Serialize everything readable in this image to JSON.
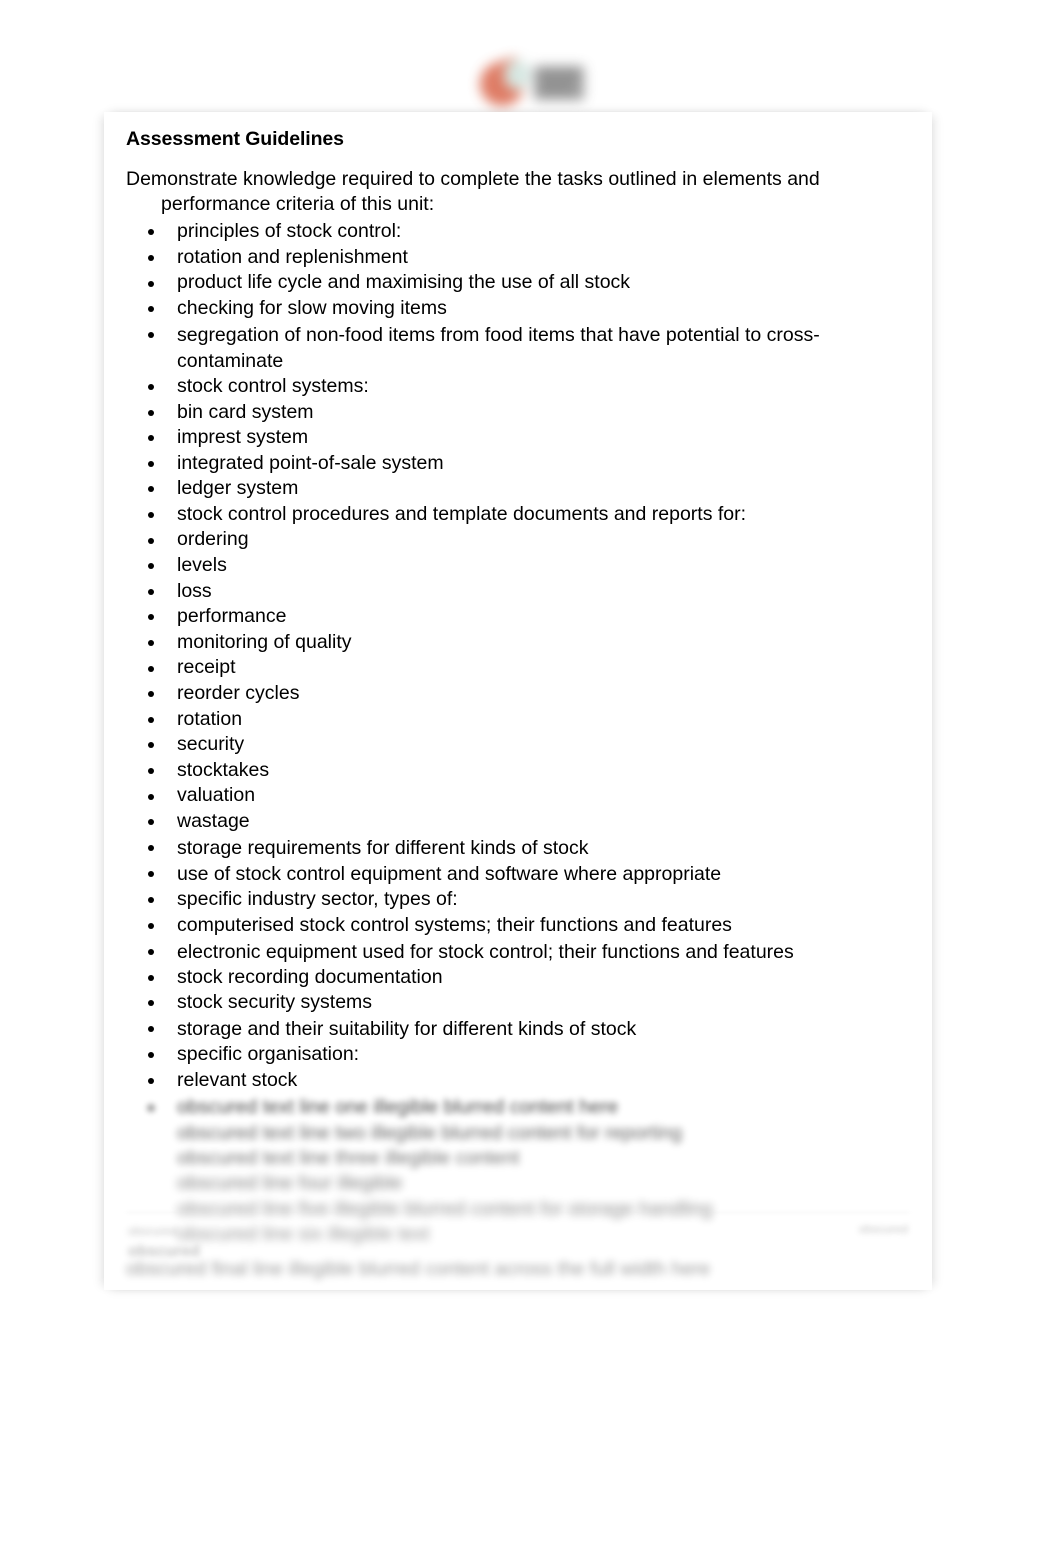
{
  "document": {
    "heading": "Assessment Guidelines",
    "intro": {
      "line1": "Demonstrate knowledge required to complete the tasks outlined in elements and",
      "line2": "performance criteria of this unit:"
    },
    "bullets": [
      "principles of stock control:",
      "rotation and replenishment",
      "product life cycle and maximising the use of all stock",
      "checking for slow moving items",
      "segregation of non-food items from food items that have potential to cross-contaminate",
      "stock control systems:",
      "bin card system",
      "imprest system",
      "integrated point-of-sale system",
      "ledger system",
      "stock control procedures and template documents and reports for:",
      "ordering",
      "levels",
      "loss",
      "performance",
      "monitoring of quality",
      "receipt",
      "reorder cycles",
      "rotation",
      "security",
      "stocktakes",
      "valuation",
      "wastage",
      "storage requirements for different kinds of stock",
      "use of stock control equipment and software where appropriate",
      "specific industry sector, types of:",
      "computerised stock control systems; their functions and features",
      "electronic equipment used for stock control; their functions and features",
      "stock recording documentation",
      "stock security systems",
      "storage and their suitability for different kinds of stock",
      "specific organisation:",
      "relevant stock"
    ],
    "obscured_tail": {
      "note": "illegible (blurred in source image)",
      "lines": [
        "obscured text line one illegible blurred content here",
        "obscured text line two illegible blurred content for reporting",
        "obscured text line three illegible content",
        "obscured line four illegible",
        "obscured line five illegible blurred content for storage handling",
        "obscured line six illegible text",
        "obscured final line illegible blurred content across the full width here"
      ]
    }
  },
  "logo": {
    "name": "organisation-logo",
    "note": "blurred emblem: orange swoosh with grey block",
    "accent_color": "#d9654a",
    "block_color": "#8d8d8d"
  },
  "footer": {
    "left_line1": "obscured",
    "left_line2": "obscured",
    "right": "obscured"
  },
  "colors": {
    "page_background": "#ffffff",
    "canvas_background": "#ffffff",
    "text": "#000000"
  }
}
